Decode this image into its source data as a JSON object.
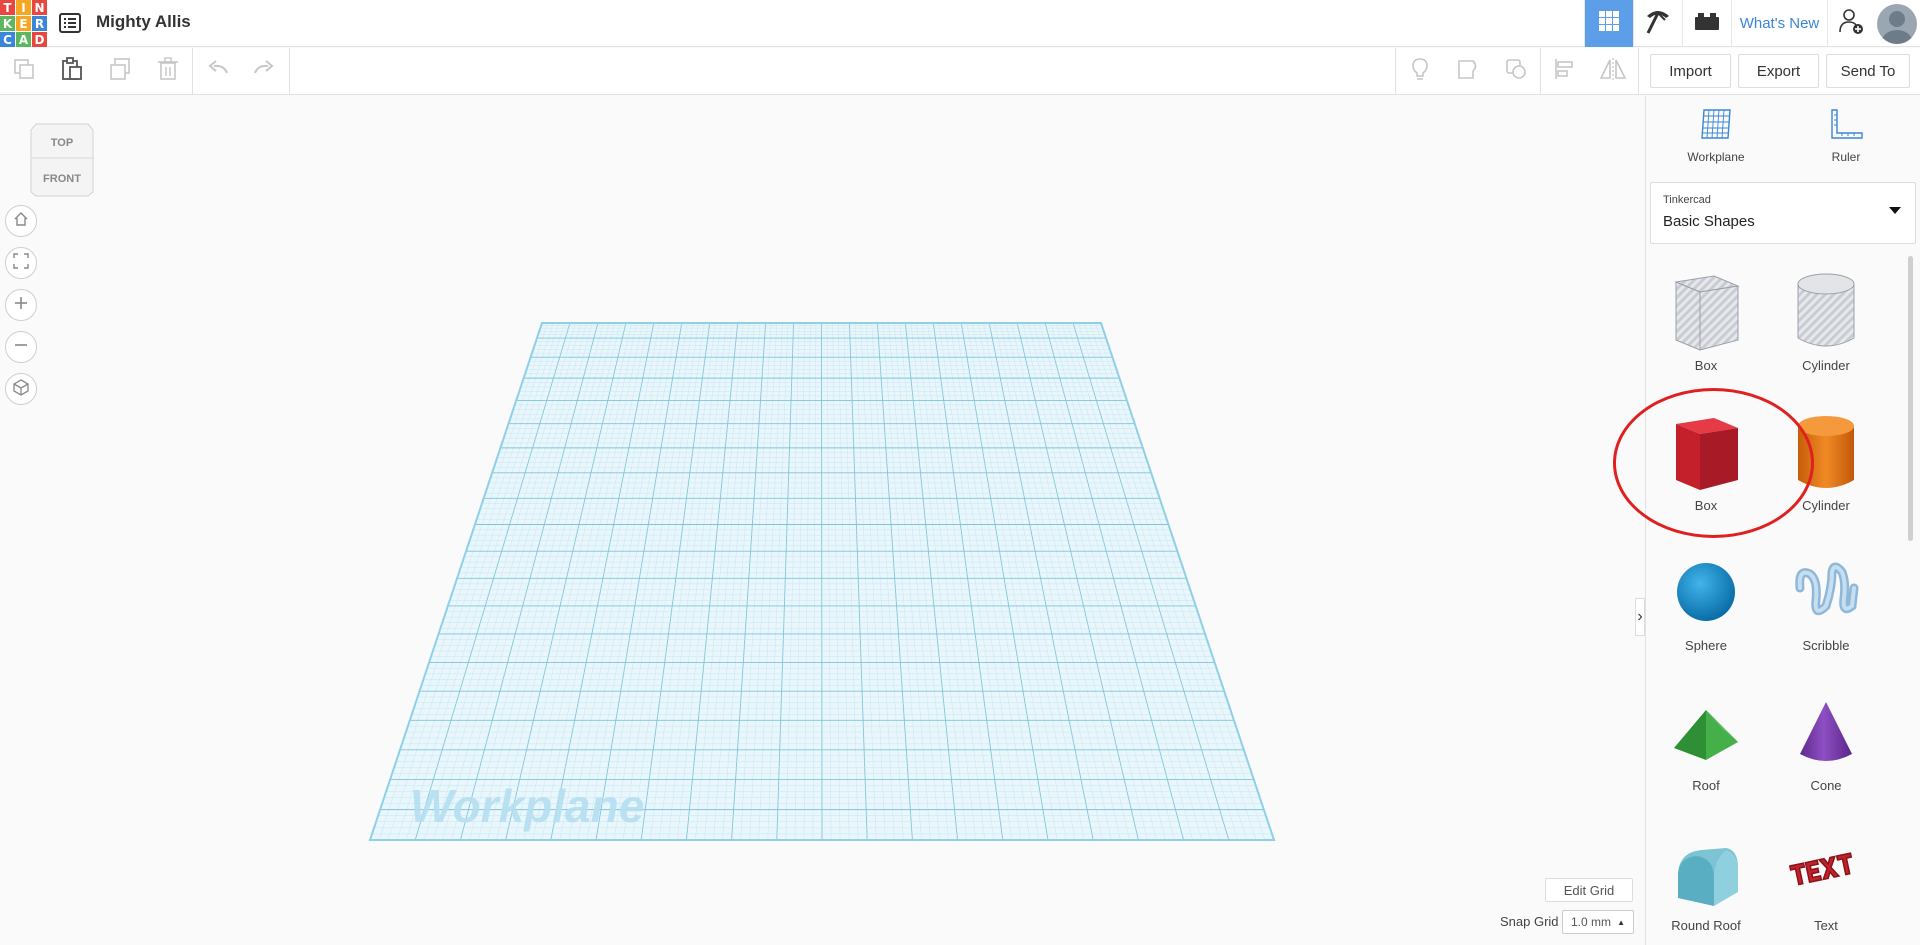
{
  "app": {
    "logo_letters": [
      "T",
      "I",
      "N",
      "K",
      "E",
      "R",
      "C",
      "A",
      "D"
    ],
    "logo_colors": [
      "#e8463f",
      "#f5a623",
      "#e8463f",
      "#5cb85c",
      "#f5a623",
      "#3b86d6",
      "#3b86d6",
      "#5cb85c",
      "#e8463f"
    ],
    "design_title": "Mighty Allis"
  },
  "topnav": {
    "whats_new": "What's New",
    "active_color": "#5c9ee8"
  },
  "toolbar": {
    "import_label": "Import",
    "export_label": "Export",
    "send_to_label": "Send To"
  },
  "viewcube": {
    "top": "TOP",
    "front": "FRONT"
  },
  "viewport": {
    "workplane_label": "Workplane",
    "edit_grid": "Edit Grid",
    "snap_grid_label": "Snap Grid",
    "snap_grid_value": "1.0 mm"
  },
  "panel": {
    "workplane_label": "Workplane",
    "ruler_label": "Ruler",
    "library_source": "Tinkercad",
    "library_name": "Basic Shapes",
    "shapes": [
      {
        "label": "Box",
        "icon": "box-hole-icon"
      },
      {
        "label": "Cylinder",
        "icon": "cylinder-hole-icon"
      },
      {
        "label": "Box",
        "icon": "box-solid-icon"
      },
      {
        "label": "Cylinder",
        "icon": "cylinder-solid-icon"
      },
      {
        "label": "Sphere",
        "icon": "sphere-icon"
      },
      {
        "label": "Scribble",
        "icon": "scribble-icon"
      },
      {
        "label": "Roof",
        "icon": "roof-icon"
      },
      {
        "label": "Cone",
        "icon": "cone-icon"
      },
      {
        "label": "Round Roof",
        "icon": "round-roof-icon"
      },
      {
        "label": "Text",
        "icon": "text-shape-icon"
      }
    ],
    "highlight_color": "#e02020"
  }
}
